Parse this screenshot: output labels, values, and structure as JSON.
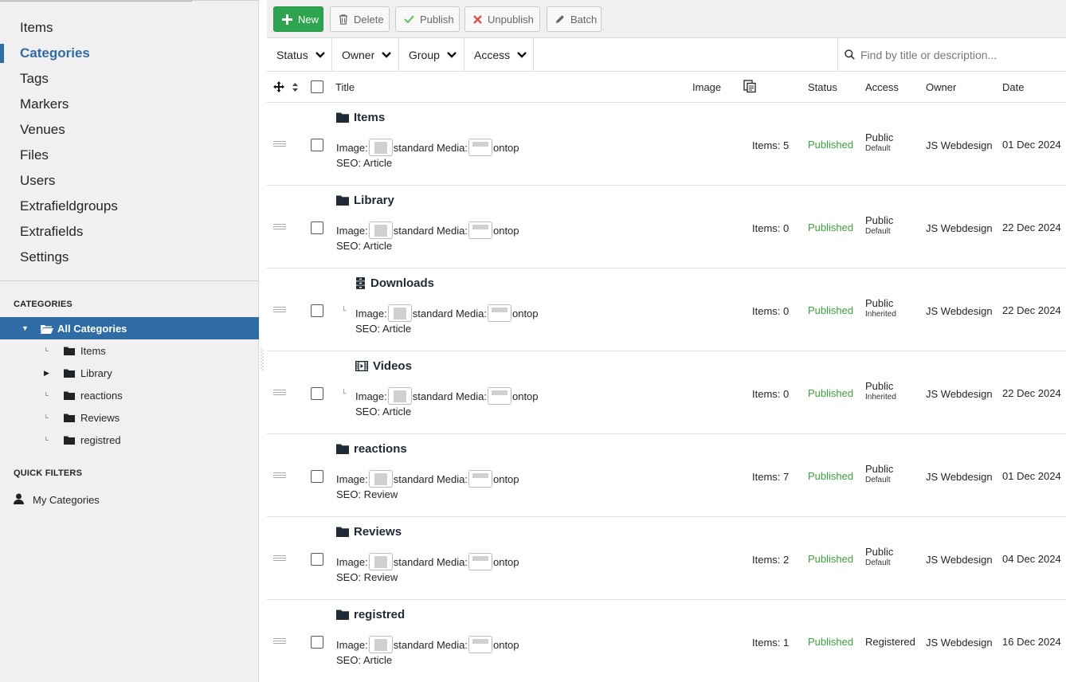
{
  "sidebar": {
    "nav": [
      "Items",
      "Categories",
      "Tags",
      "Markers",
      "Venues",
      "Files",
      "Users",
      "Extrafieldgroups",
      "Extrafields",
      "Settings"
    ],
    "active": "Categories",
    "categories_heading": "CATEGORIES",
    "tree_all": "All Categories",
    "tree": [
      {
        "label": "Items",
        "expandable": false
      },
      {
        "label": "Library",
        "expandable": true
      },
      {
        "label": "reactions",
        "expandable": false
      },
      {
        "label": "Reviews",
        "expandable": false
      },
      {
        "label": "registred",
        "expandable": false
      }
    ],
    "quick_heading": "QUICK FILTERS",
    "quick_item": "My Categories"
  },
  "toolbar": {
    "new": "New",
    "delete": "Delete",
    "publish": "Publish",
    "unpublish": "Unpublish",
    "batch": "Batch"
  },
  "filters": {
    "status": "Status",
    "owner": "Owner",
    "group": "Group",
    "access": "Access",
    "search_placeholder": "Find by title or description..."
  },
  "table": {
    "headers": {
      "title": "Title",
      "image": "Image",
      "status": "Status",
      "access": "Access",
      "owner": "Owner",
      "date": "Date"
    },
    "labels": {
      "image": "Image:",
      "standard_media": "standard Media:",
      "ontop": "ontop"
    },
    "rows": [
      {
        "title": "Items",
        "icon": "folder-icon",
        "child": false,
        "seo": "SEO: Article",
        "count": "Items: 5",
        "status": "Published",
        "access": "Public",
        "access_sub": "Default",
        "owner": "JS Webdesign",
        "date": "01 Dec 2024"
      },
      {
        "title": "Library",
        "icon": "folder-icon",
        "child": false,
        "seo": "SEO: Article",
        "count": "Items: 0",
        "status": "Published",
        "access": "Public",
        "access_sub": "Default",
        "owner": "JS Webdesign",
        "date": "22 Dec 2024"
      },
      {
        "title": "Downloads",
        "icon": "archive-icon",
        "child": true,
        "seo": "SEO: Article",
        "count": "Items: 0",
        "status": "Published",
        "access": "Public",
        "access_sub": "Inherited",
        "owner": "JS Webdesign",
        "date": "22 Dec 2024"
      },
      {
        "title": "Videos",
        "icon": "film-icon",
        "child": true,
        "seo": "SEO: Article",
        "count": "Items: 0",
        "status": "Published",
        "access": "Public",
        "access_sub": "Inherited",
        "owner": "JS Webdesign",
        "date": "22 Dec 2024"
      },
      {
        "title": "reactions",
        "icon": "folder-icon",
        "child": false,
        "seo": "SEO: Review",
        "count": "Items: 7",
        "status": "Published",
        "access": "Public",
        "access_sub": "Default",
        "owner": "JS Webdesign",
        "date": "01 Dec 2024"
      },
      {
        "title": "Reviews",
        "icon": "folder-icon",
        "child": false,
        "seo": "SEO: Review",
        "count": "Items: 2",
        "status": "Published",
        "access": "Public",
        "access_sub": "Default",
        "owner": "JS Webdesign",
        "date": "04 Dec 2024"
      },
      {
        "title": "registred",
        "icon": "folder-icon",
        "child": false,
        "seo": "SEO: Article",
        "count": "Items: 1",
        "status": "Published",
        "access": "Registered",
        "access_sub": "",
        "owner": "JS Webdesign",
        "date": "16 Dec 2024"
      }
    ]
  },
  "colors": {
    "accent": "#2f6ca5",
    "new_button": "#2ea44f",
    "published": "#3aa03a"
  }
}
